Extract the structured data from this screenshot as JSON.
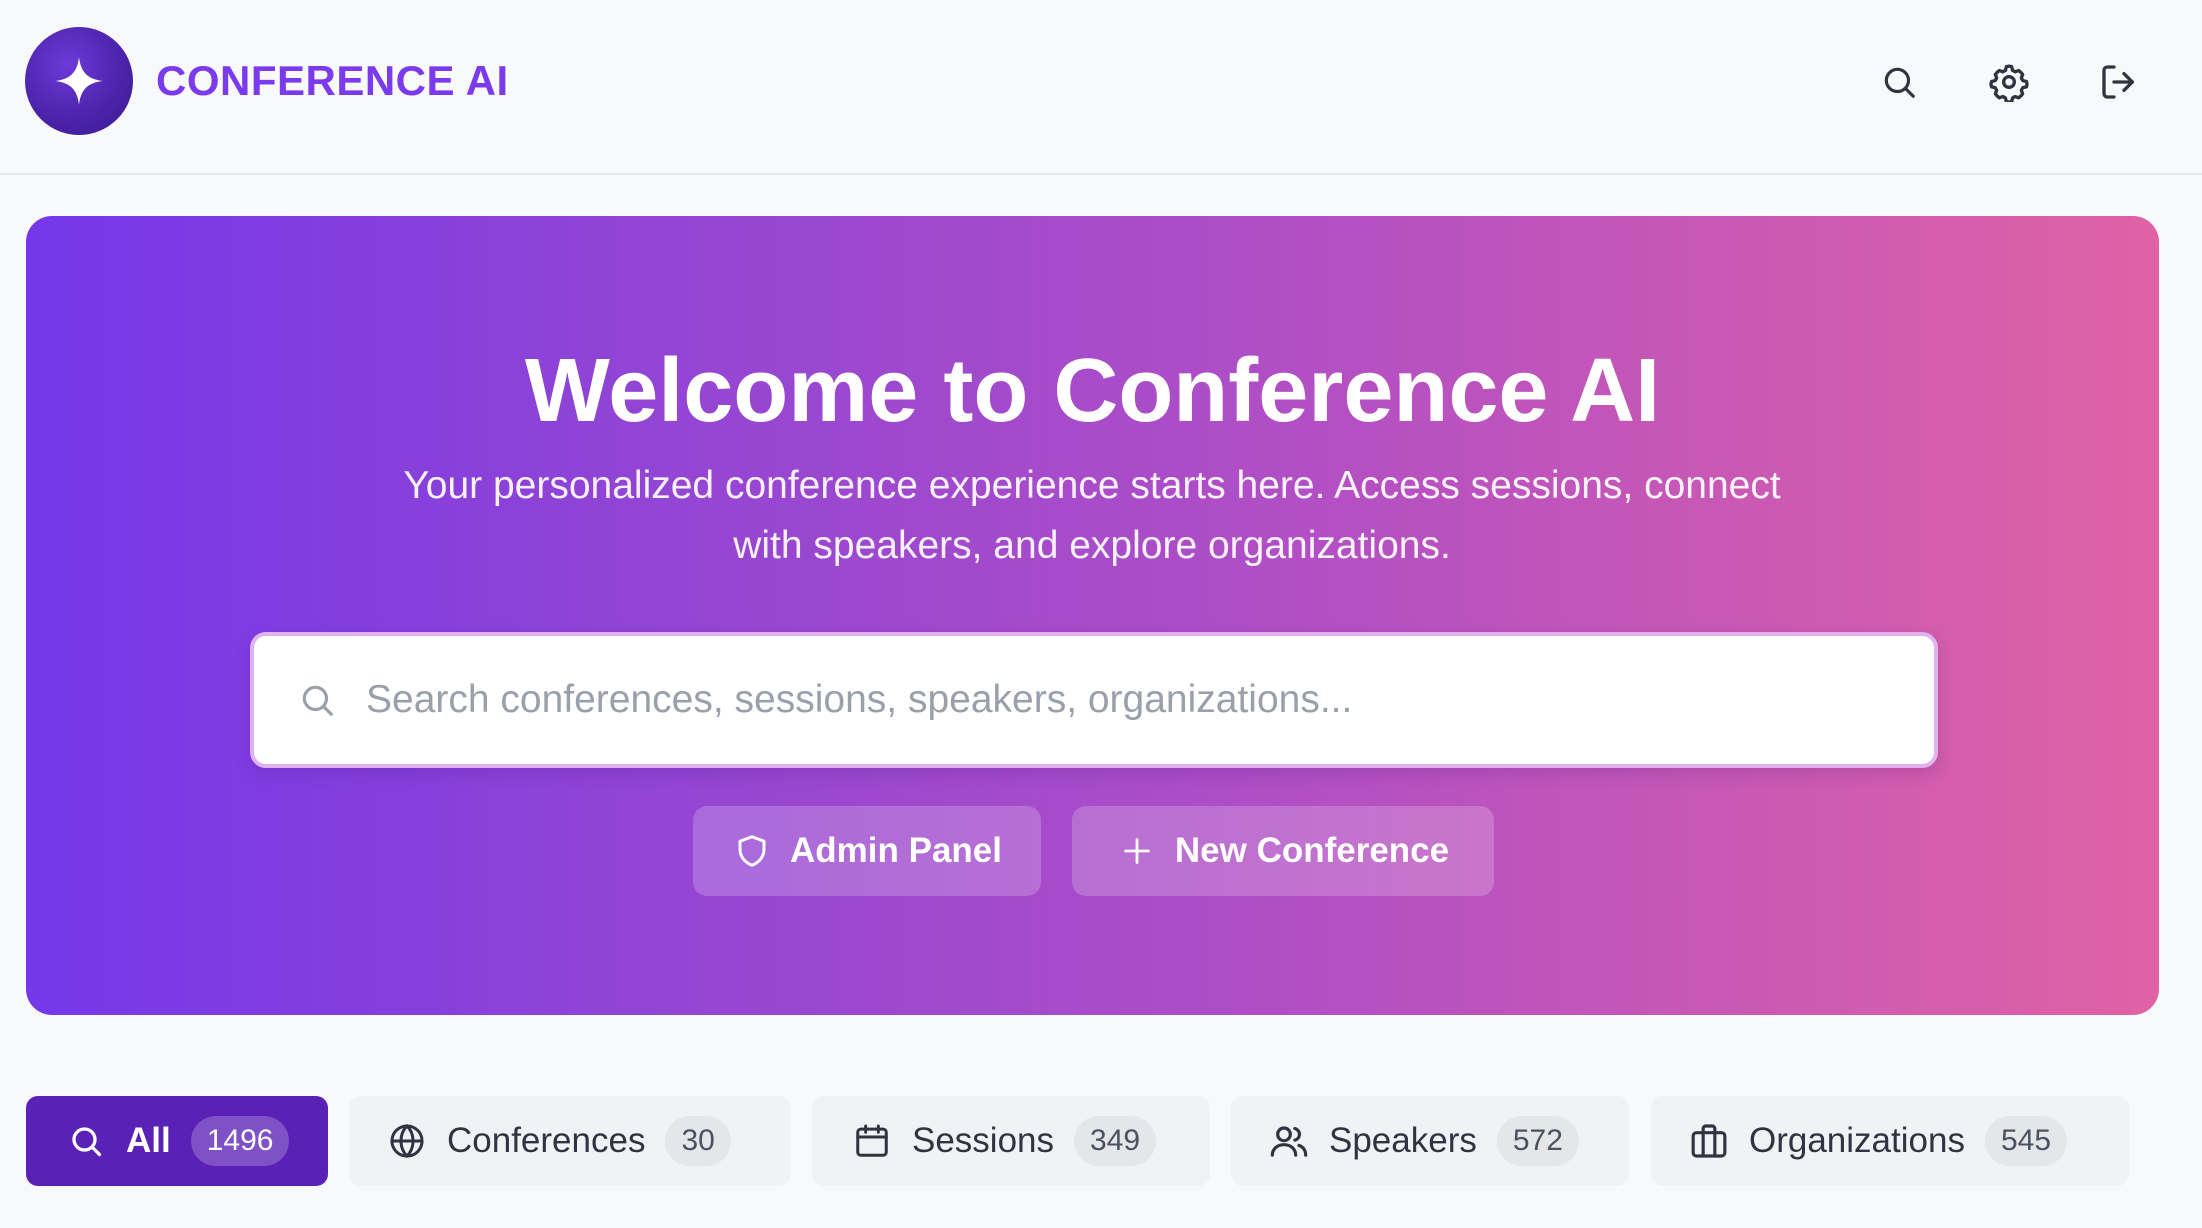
{
  "header": {
    "app_title": "CONFERENCE AI",
    "logo_icon": "sparkle-icon",
    "actions": [
      {
        "name": "search",
        "icon": "search-icon"
      },
      {
        "name": "settings",
        "icon": "gear-icon"
      },
      {
        "name": "logout",
        "icon": "logout-icon"
      }
    ]
  },
  "hero": {
    "title": "Welcome to Conference AI",
    "subtitle": "Your personalized conference experience starts here. Access sessions, connect with speakers, and explore organizations.",
    "search_placeholder": "Search conferences, sessions, speakers, organizations...",
    "search_value": "",
    "buttons": {
      "admin_label": "Admin Panel",
      "new_conference_label": "New Conference"
    }
  },
  "tabs": [
    {
      "label": "All",
      "count": "1496",
      "icon": "search-icon",
      "active": true
    },
    {
      "label": "Conferences",
      "count": "30",
      "icon": "globe-icon",
      "active": false
    },
    {
      "label": "Sessions",
      "count": "349",
      "icon": "calendar-icon",
      "active": false
    },
    {
      "label": "Speakers",
      "count": "572",
      "icon": "users-icon",
      "active": false
    },
    {
      "label": "Organizations",
      "count": "545",
      "icon": "briefcase-icon",
      "active": false
    }
  ],
  "colors": {
    "brand": "#7c3aed",
    "active_tab": "#5b21b6",
    "hero_gradient_start": "#7537e9",
    "hero_gradient_end": "#e062a5"
  }
}
